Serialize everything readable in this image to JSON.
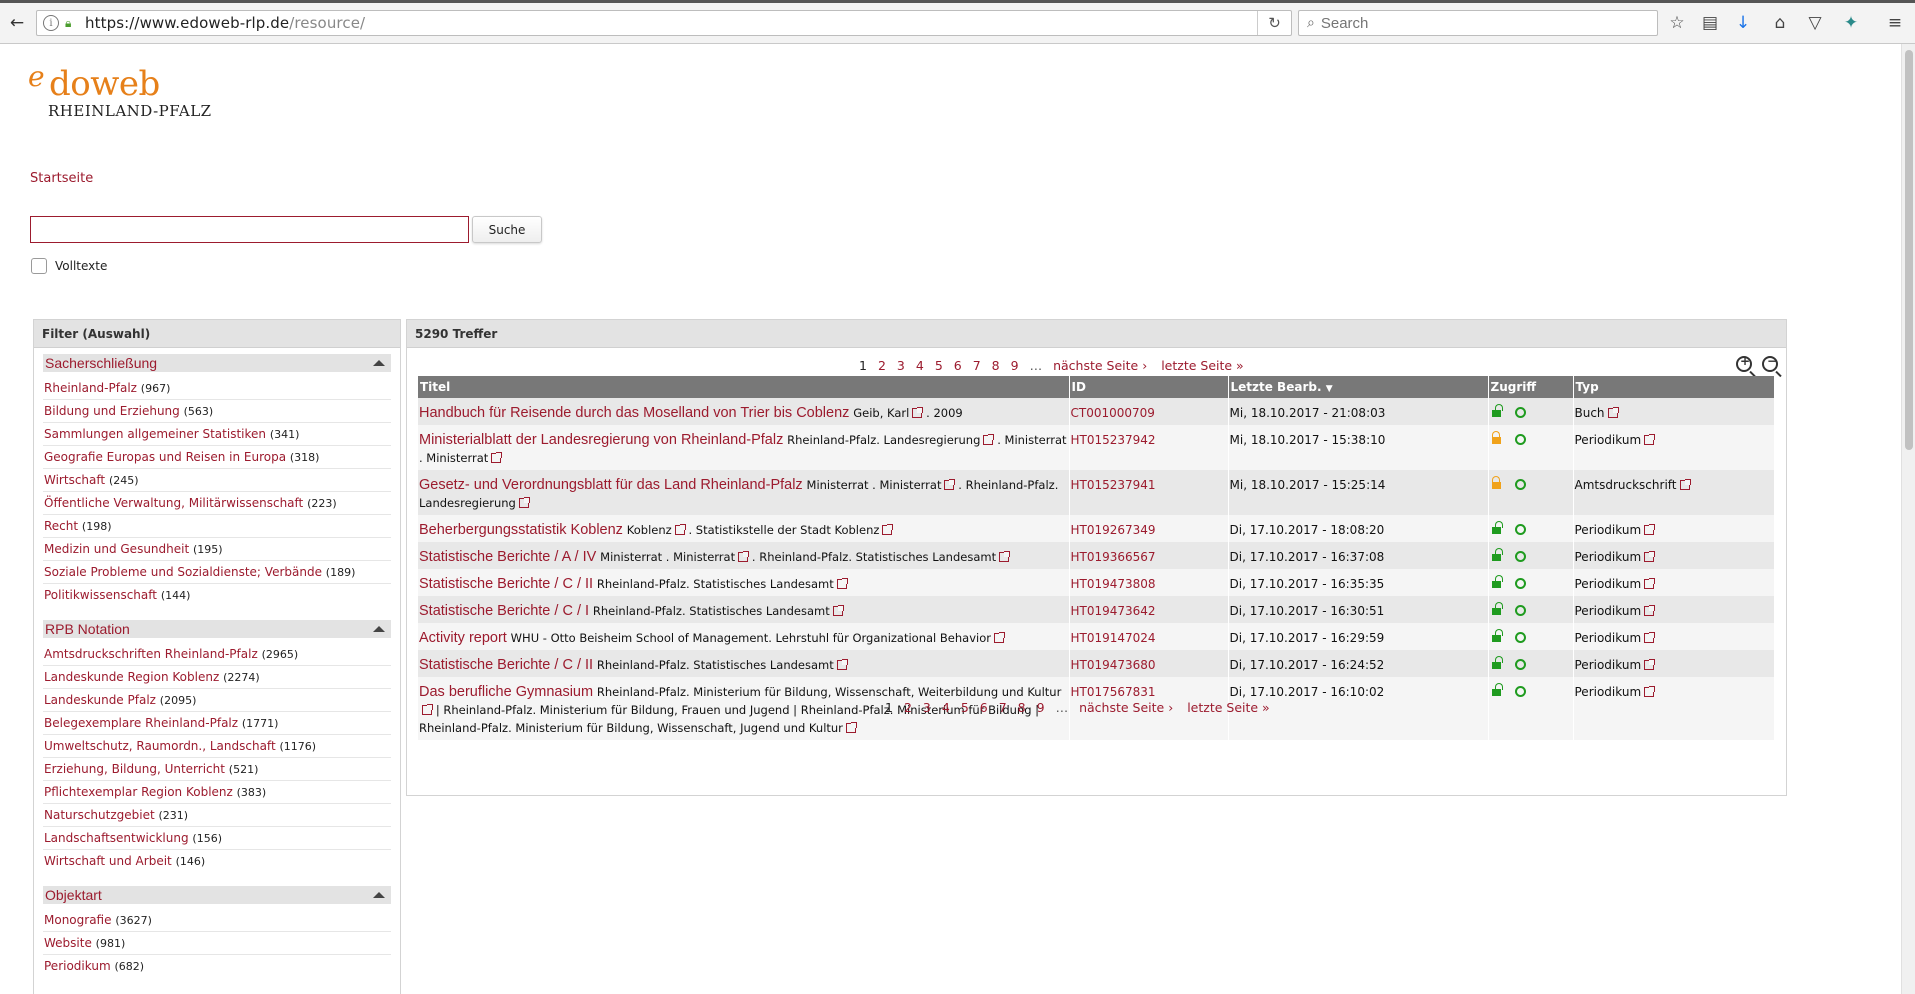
{
  "browser": {
    "url_host": "https://www.edoweb-rlp.de",
    "url_path": "/resource/",
    "search_placeholder": "Search"
  },
  "site": {
    "logo_e": "e",
    "logo_main": "doweb",
    "logo_sub": "RHEINLAND-PFALZ",
    "breadcrumb": "Startseite",
    "search_value": "",
    "search_button": "Suche",
    "fulltext_label": "Volltexte"
  },
  "filter": {
    "title": "Filter (Auswahl)",
    "facets": [
      {
        "title": "Sacherschließung",
        "items": [
          {
            "label": "Rheinland-Pfalz",
            "count": "(967)"
          },
          {
            "label": "Bildung und Erziehung",
            "count": "(563)"
          },
          {
            "label": "Sammlungen allgemeiner Statistiken",
            "count": "(341)"
          },
          {
            "label": "Geografie Europas und Reisen in Europa",
            "count": "(318)"
          },
          {
            "label": "Wirtschaft",
            "count": "(245)"
          },
          {
            "label": "Öffentliche Verwaltung, Militärwissenschaft",
            "count": "(223)"
          },
          {
            "label": "Recht",
            "count": "(198)"
          },
          {
            "label": "Medizin und Gesundheit",
            "count": "(195)"
          },
          {
            "label": "Soziale Probleme und Sozialdienste; Verbände",
            "count": "(189)"
          },
          {
            "label": "Politikwissenschaft",
            "count": "(144)"
          }
        ]
      },
      {
        "title": "RPB Notation",
        "items": [
          {
            "label": "Amtsdruckschriften Rheinland-Pfalz",
            "count": "(2965)"
          },
          {
            "label": "Landeskunde Region Koblenz",
            "count": "(2274)"
          },
          {
            "label": "Landeskunde Pfalz",
            "count": "(2095)"
          },
          {
            "label": "Belegexemplare Rheinland-Pfalz",
            "count": "(1771)"
          },
          {
            "label": "Umweltschutz, Raumordn., Landschaft",
            "count": "(1176)"
          },
          {
            "label": "Erziehung, Bildung, Unterricht",
            "count": "(521)"
          },
          {
            "label": "Pflichtexemplar Region Koblenz",
            "count": "(383)"
          },
          {
            "label": "Naturschutzgebiet",
            "count": "(231)"
          },
          {
            "label": "Landschaftsentwicklung",
            "count": "(156)"
          },
          {
            "label": "Wirtschaft und Arbeit",
            "count": "(146)"
          }
        ]
      },
      {
        "title": "Objektart",
        "items": [
          {
            "label": "Monografie",
            "count": "(3627)"
          },
          {
            "label": "Website",
            "count": "(981)"
          },
          {
            "label": "Periodikum",
            "count": "(682)"
          }
        ]
      }
    ]
  },
  "results": {
    "count_label": "5290 Treffer",
    "pager": {
      "current": "1",
      "pages": [
        "2",
        "3",
        "4",
        "5",
        "6",
        "7",
        "8",
        "9"
      ],
      "dots": "…",
      "next": "nächste Seite ›",
      "last": "letzte Seite »"
    },
    "columns": {
      "title": "Titel",
      "id": "ID",
      "date": "Letzte Bearb.",
      "access": "Zugriff",
      "type": "Typ"
    },
    "rows": [
      {
        "title": "Handbuch für Reisende durch das Moselland von Trier bis Coblenz",
        "sub": "Geib, Karl",
        "sub2": ". 2009",
        "id": "CT001000709",
        "date": "Mi, 18.10.2017 - 21:08:03",
        "lock": "open",
        "type": "Buch"
      },
      {
        "title": "Ministerialblatt der Landesregierung von Rheinland-Pfalz",
        "sub": "Rheinland-Pfalz. Landesregierung",
        "sub2": ". Ministerrat . Ministerrat",
        "id": "HT015237942",
        "date": "Mi, 18.10.2017 - 15:38:10",
        "lock": "closed",
        "type": "Periodikum"
      },
      {
        "title": "Gesetz- und Verordnungsblatt für das Land Rheinland-Pfalz",
        "sub": "Ministerrat . Ministerrat",
        "sub2": ". Rheinland-Pfalz. Landesregierung",
        "id": "HT015237941",
        "date": "Mi, 18.10.2017 - 15:25:14",
        "lock": "closed",
        "type": "Amtsdruckschrift"
      },
      {
        "title": "Beherbergungsstatistik Koblenz",
        "sub": "Koblenz",
        "sub2": ". Statistikstelle der Stadt Koblenz",
        "id": "HT019267349",
        "date": "Di, 17.10.2017 - 18:08:20",
        "lock": "open",
        "type": "Periodikum"
      },
      {
        "title": "Statistische Berichte / A / IV",
        "sub": "Ministerrat . Ministerrat",
        "sub2": ". Rheinland-Pfalz. Statistisches Landesamt",
        "id": "HT019366567",
        "date": "Di, 17.10.2017 - 16:37:08",
        "lock": "open",
        "type": "Periodikum"
      },
      {
        "title": "Statistische Berichte / C / II",
        "sub": "Rheinland-Pfalz. Statistisches Landesamt",
        "sub2": "",
        "id": "HT019473808",
        "date": "Di, 17.10.2017 - 16:35:35",
        "lock": "open",
        "type": "Periodikum"
      },
      {
        "title": "Statistische Berichte / C / I",
        "sub": "Rheinland-Pfalz. Statistisches Landesamt",
        "sub2": "",
        "id": "HT019473642",
        "date": "Di, 17.10.2017 - 16:30:51",
        "lock": "open",
        "type": "Periodikum"
      },
      {
        "title": "Activity report",
        "sub": "WHU - Otto Beisheim School of Management. Lehrstuhl für Organizational Behavior",
        "sub2": "",
        "id": "HT019147024",
        "date": "Di, 17.10.2017 - 16:29:59",
        "lock": "open",
        "type": "Periodikum"
      },
      {
        "title": "Statistische Berichte / C / II",
        "sub": "Rheinland-Pfalz. Statistisches Landesamt",
        "sub2": "",
        "id": "HT019473680",
        "date": "Di, 17.10.2017 - 16:24:52",
        "lock": "open",
        "type": "Periodikum"
      },
      {
        "title": "Das berufliche Gymnasium",
        "sub": "Rheinland-Pfalz. Ministerium für Bildung, Wissenschaft, Weiterbildung und Kultur",
        "sub2": "| Rheinland-Pfalz. Ministerium für Bildung, Frauen und Jugend | Rheinland-Pfalz. Ministerium für Bildung | Rheinland-Pfalz. Ministerium für Bildung, Wissenschaft, Jugend und Kultur",
        "id": "HT017567831",
        "date": "Di, 17.10.2017 - 16:10:02",
        "lock": "open",
        "type": "Periodikum"
      }
    ]
  }
}
